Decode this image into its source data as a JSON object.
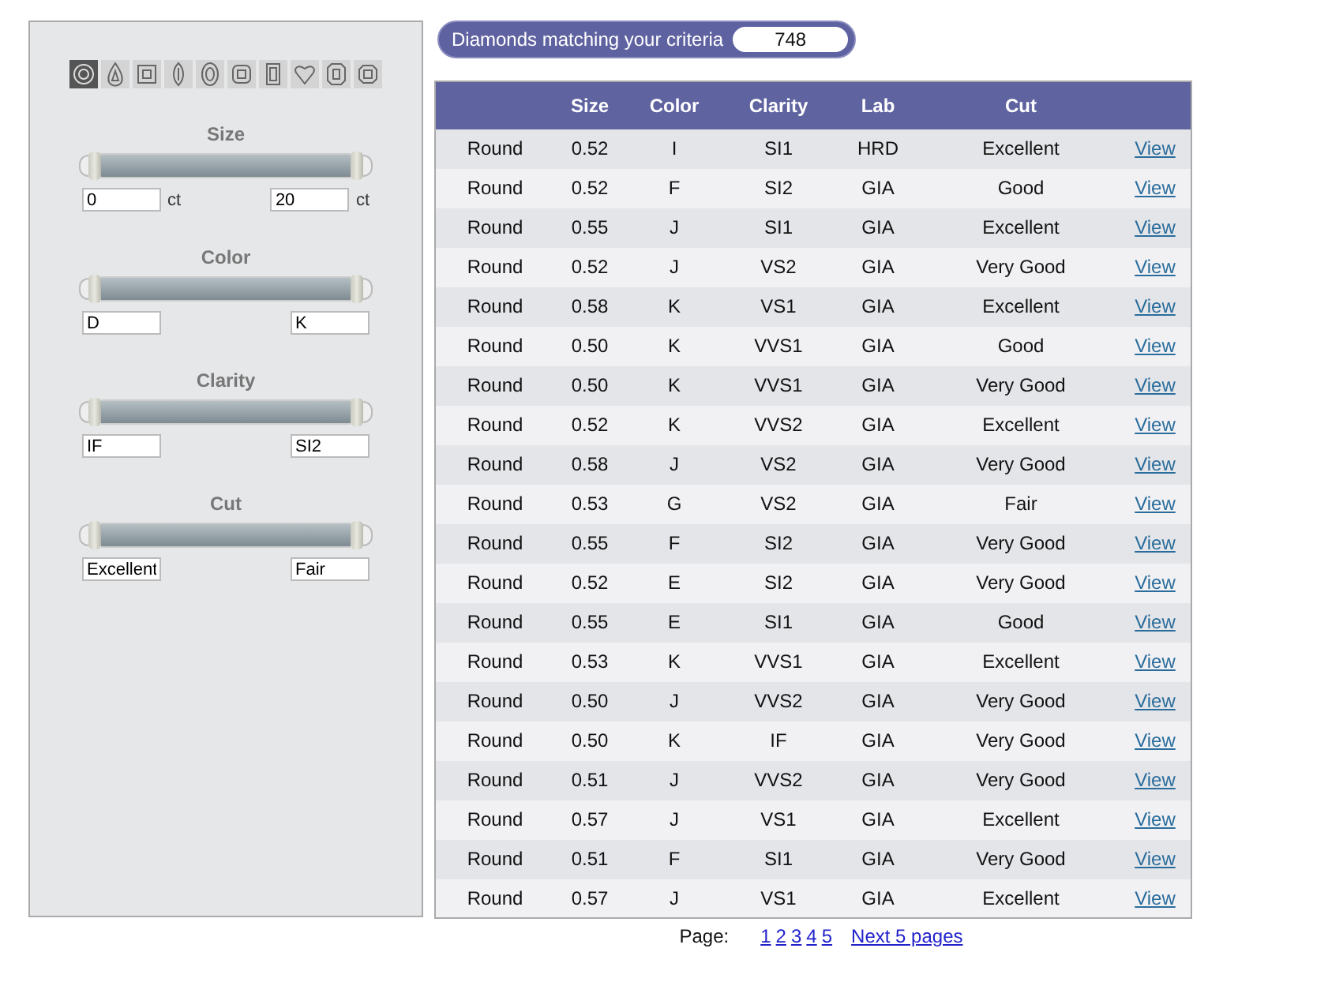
{
  "shapes": [
    {
      "kind": "round",
      "selected": true
    },
    {
      "kind": "pear",
      "selected": false
    },
    {
      "kind": "princess",
      "selected": false
    },
    {
      "kind": "marquise",
      "selected": false
    },
    {
      "kind": "oval",
      "selected": false
    },
    {
      "kind": "cushion",
      "selected": false
    },
    {
      "kind": "emerald",
      "selected": false
    },
    {
      "kind": "heart",
      "selected": false
    },
    {
      "kind": "radiant",
      "selected": false
    },
    {
      "kind": "asscher",
      "selected": false
    }
  ],
  "filters": [
    {
      "title": "Size",
      "level": 1,
      "min": "0",
      "max": "20",
      "min_unit": "ct",
      "max_unit": "ct"
    },
    {
      "title": "Color",
      "level": 1,
      "min": "D",
      "max": "K"
    },
    {
      "title": "Clarity",
      "level": 1,
      "min": "IF",
      "max": "SI2"
    },
    {
      "title": "Cut",
      "level": 1,
      "min": "Excellent",
      "max": "Fair"
    }
  ],
  "match": {
    "label": "Diamonds matching your criteria",
    "count": "748"
  },
  "table": {
    "columns": [
      "",
      "Size",
      "Color",
      "Clarity",
      "Lab",
      "Cut",
      ""
    ],
    "rows": [
      [
        "Round",
        "0.52",
        "I",
        "SI1",
        "HRD",
        "Excellent",
        "View"
      ],
      [
        "Round",
        "0.52",
        "F",
        "SI2",
        "GIA",
        "Good",
        "View"
      ],
      [
        "Round",
        "0.55",
        "J",
        "SI1",
        "GIA",
        "Excellent",
        "View"
      ],
      [
        "Round",
        "0.52",
        "J",
        "VS2",
        "GIA",
        "Very Good",
        "View"
      ],
      [
        "Round",
        "0.58",
        "K",
        "VS1",
        "GIA",
        "Excellent",
        "View"
      ],
      [
        "Round",
        "0.50",
        "K",
        "VVS1",
        "GIA",
        "Good",
        "View"
      ],
      [
        "Round",
        "0.50",
        "K",
        "VVS1",
        "GIA",
        "Very Good",
        "View"
      ],
      [
        "Round",
        "0.52",
        "K",
        "VVS2",
        "GIA",
        "Excellent",
        "View"
      ],
      [
        "Round",
        "0.58",
        "J",
        "VS2",
        "GIA",
        "Very Good",
        "View"
      ],
      [
        "Round",
        "0.53",
        "G",
        "VS2",
        "GIA",
        "Fair",
        "View"
      ],
      [
        "Round",
        "0.55",
        "F",
        "SI2",
        "GIA",
        "Very Good",
        "View"
      ],
      [
        "Round",
        "0.52",
        "E",
        "SI2",
        "GIA",
        "Very Good",
        "View"
      ],
      [
        "Round",
        "0.55",
        "E",
        "SI1",
        "GIA",
        "Good",
        "View"
      ],
      [
        "Round",
        "0.53",
        "K",
        "VVS1",
        "GIA",
        "Excellent",
        "View"
      ],
      [
        "Round",
        "0.50",
        "J",
        "VVS2",
        "GIA",
        "Very Good",
        "View"
      ],
      [
        "Round",
        "0.50",
        "K",
        "IF",
        "GIA",
        "Very Good",
        "View"
      ],
      [
        "Round",
        "0.51",
        "J",
        "VVS2",
        "GIA",
        "Very Good",
        "View"
      ],
      [
        "Round",
        "0.57",
        "J",
        "VS1",
        "GIA",
        "Excellent",
        "View"
      ],
      [
        "Round",
        "0.51",
        "F",
        "SI1",
        "GIA",
        "Very Good",
        "View"
      ],
      [
        "Round",
        "0.57",
        "J",
        "VS1",
        "GIA",
        "Excellent",
        "View"
      ]
    ]
  },
  "pager": {
    "label": "Page:",
    "pages": [
      "1",
      "2",
      "3",
      "4",
      "5"
    ],
    "next": "Next 5 pages"
  }
}
